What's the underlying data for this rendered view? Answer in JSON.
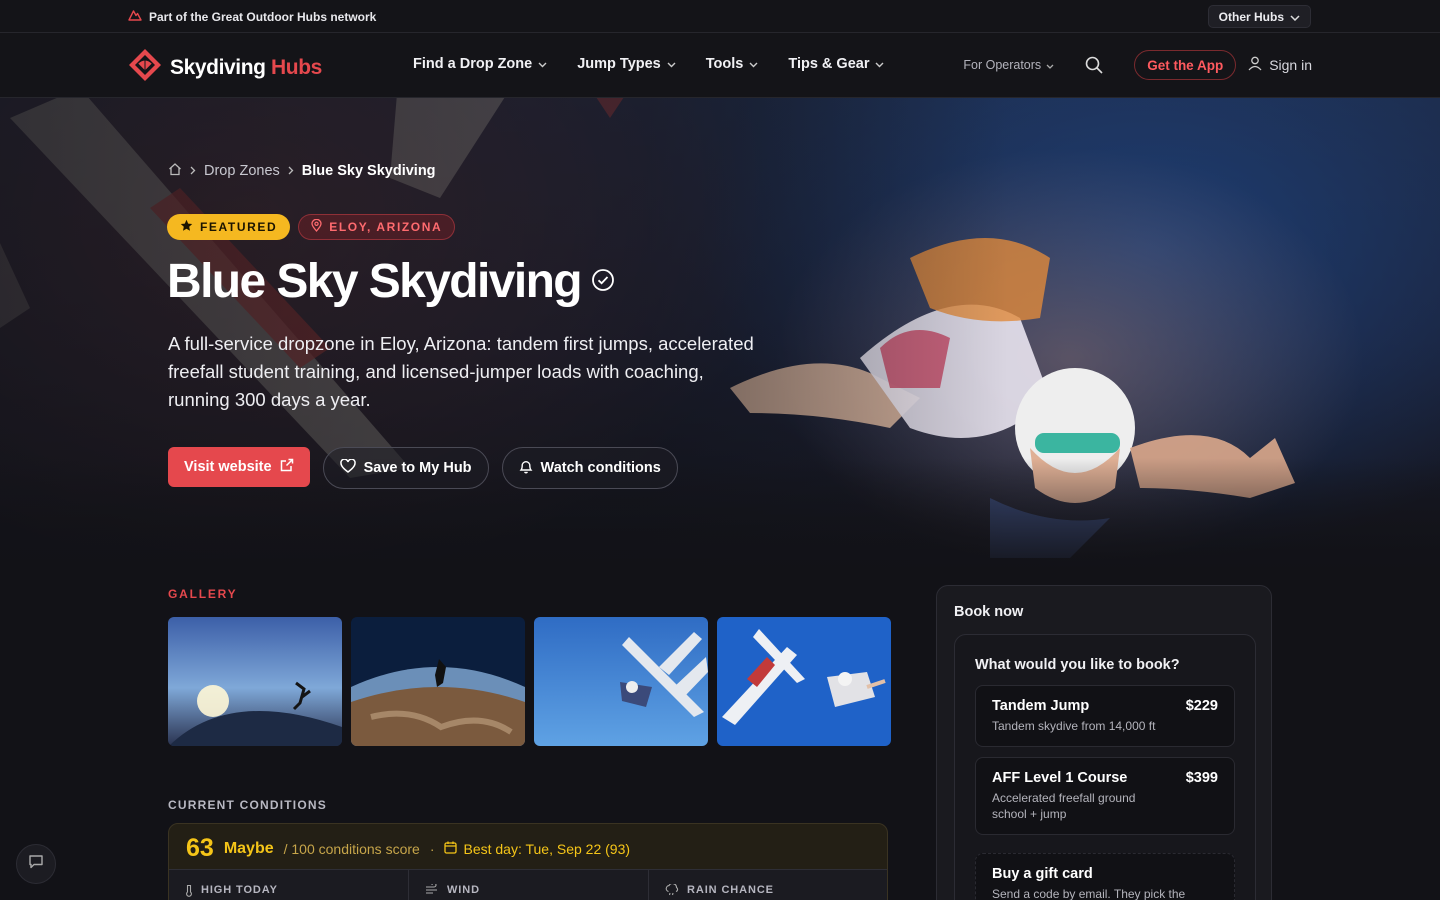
{
  "network_bar": {
    "text": "Part of the Great Outdoor Hubs network",
    "other_hubs": "Other Hubs"
  },
  "brand": {
    "name_first": "Skydiving",
    "name_second": "Hubs",
    "accent": "#e5484d"
  },
  "nav": {
    "items": [
      {
        "label": "Find a Drop Zone"
      },
      {
        "label": "Jump Types"
      },
      {
        "label": "Tools"
      },
      {
        "label": "Tips & Gear"
      }
    ],
    "for_operators": "For Operators",
    "get_app": "Get the App",
    "sign_in": "Sign in"
  },
  "breadcrumb": {
    "items": [
      "Drop Zones",
      "Blue Sky Skydiving"
    ]
  },
  "hero": {
    "badge_featured": "FEATURED",
    "badge_location": "ELOY, ARIZONA",
    "title": "Blue Sky Skydiving",
    "description": "A full-service dropzone in Eloy, Arizona: tandem first jumps, accelerated freefall student training, and licensed-jumper loads with coaching, running 300 days a year.",
    "buttons": {
      "visit": "Visit website",
      "save": "Save to My Hub",
      "watch": "Watch conditions"
    }
  },
  "gallery": {
    "label": "GALLERY"
  },
  "conditions": {
    "label": "CURRENT CONDITIONS",
    "score": "63",
    "verdict": "Maybe",
    "score_suffix": "/ 100 conditions score",
    "best_day": "Best day: Tue, Sep 22 (93)",
    "stats": [
      "HIGH TODAY",
      "WIND",
      "RAIN CHANCE"
    ],
    "color": "#f5c518"
  },
  "booking": {
    "heading": "Book now",
    "question": "What would you like to book?",
    "options": [
      {
        "name": "Tandem Jump",
        "price": "$229",
        "desc": "Tandem skydive from 14,000 ft"
      },
      {
        "name": "AFF Level 1 Course",
        "price": "$399",
        "desc": "Accelerated freefall ground school + jump"
      },
      {
        "name": "Buy a gift card",
        "price": "",
        "desc": "Send a code by email. They pick the"
      }
    ]
  }
}
